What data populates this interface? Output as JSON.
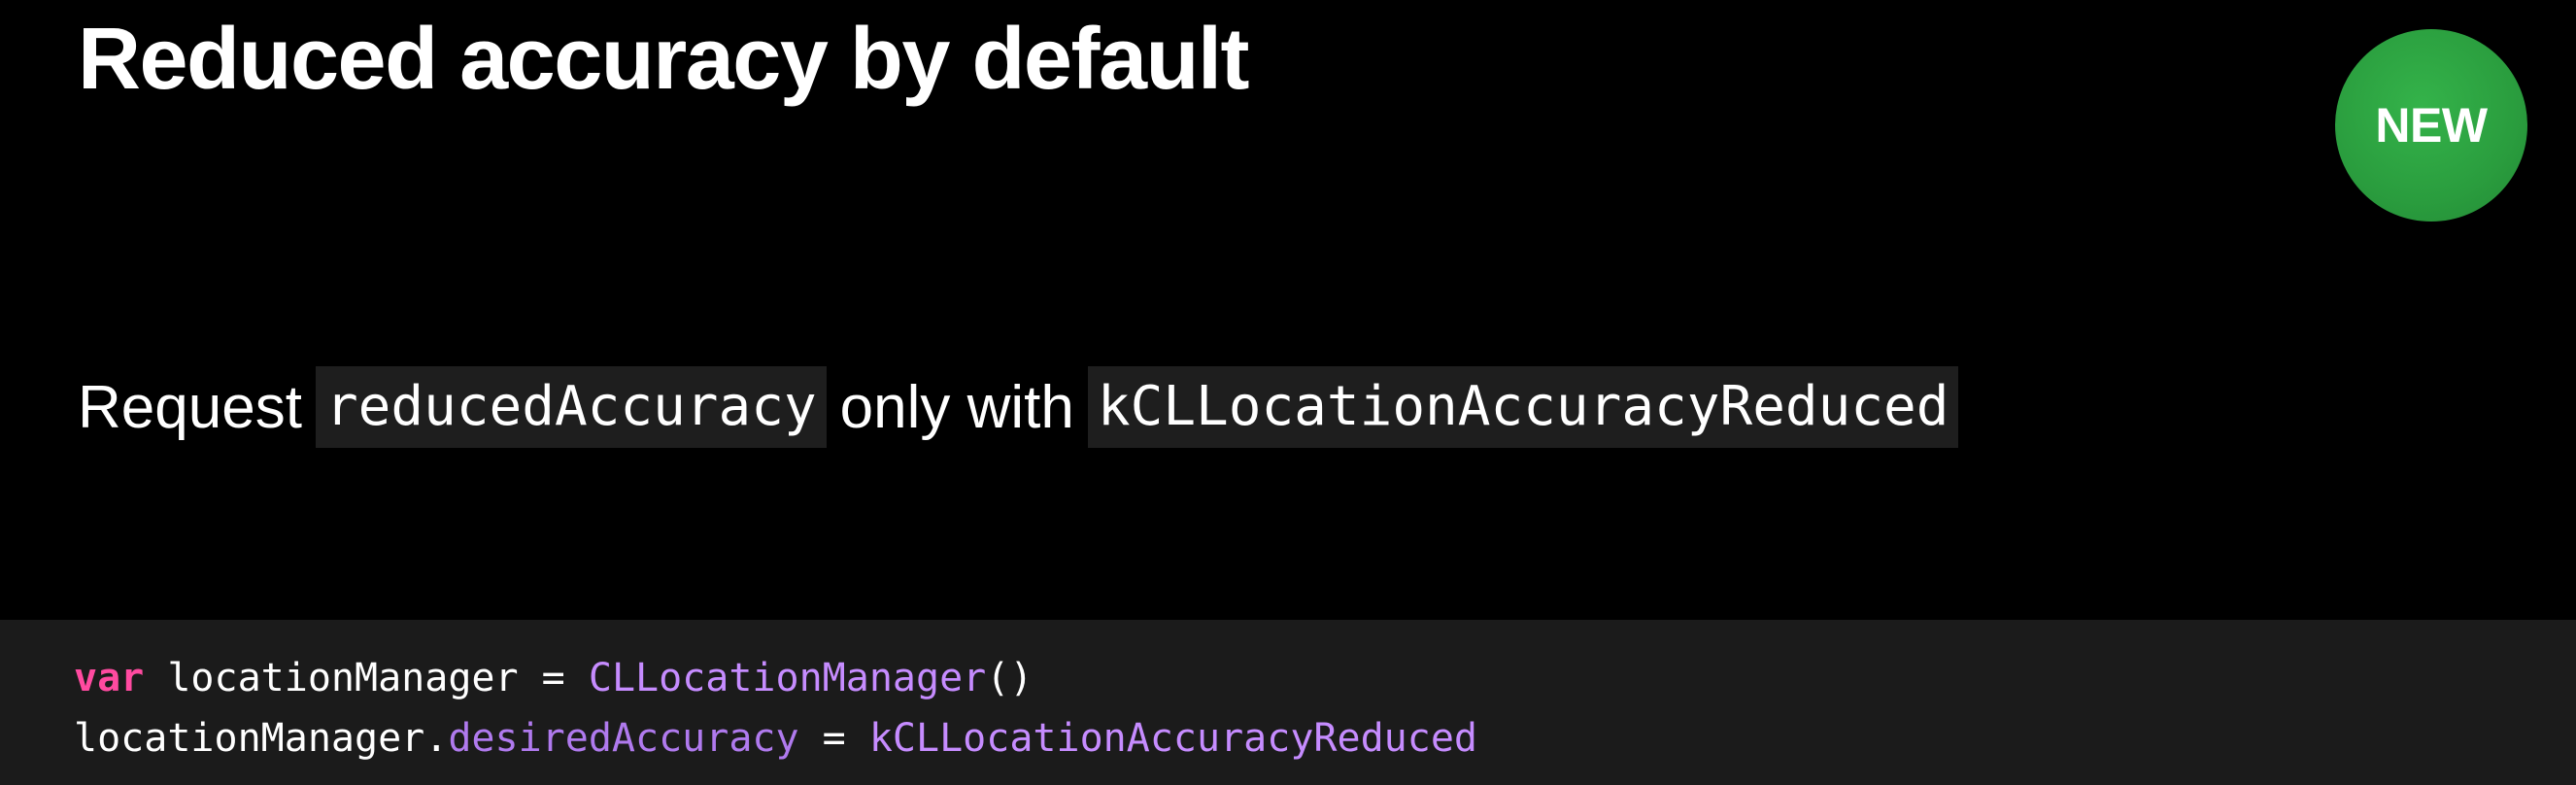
{
  "slide": {
    "title": "Reduced accuracy by default",
    "badge": "NEW",
    "body": {
      "prefix": "Request",
      "code1": "reducedAccuracy",
      "middle": "only with",
      "code2": "kCLLocationAccuracyReduced"
    },
    "code": {
      "line1": {
        "keyword": "var",
        "variable": "locationManager",
        "equals": "=",
        "type": "CLLocationManager",
        "call": "()"
      },
      "line2": {
        "receiver": "locationManager",
        "dot": ".",
        "property": "desiredAccuracy",
        "equals": "=",
        "value": "kCLLocationAccuracyReduced"
      }
    }
  },
  "colors": {
    "background": "#000000",
    "badge": "#2a9d3e",
    "code_background": "#1b1b1b",
    "keyword": "#ff4aa0",
    "type": "#c68cff",
    "property": "#b07aee"
  }
}
